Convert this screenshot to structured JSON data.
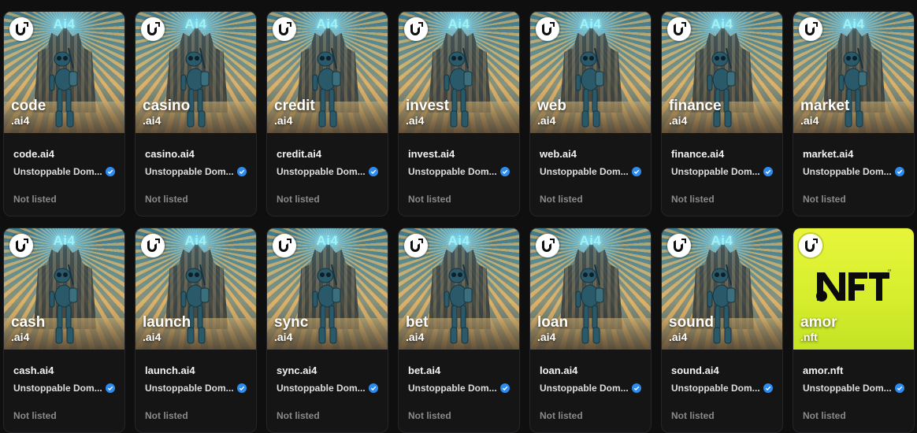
{
  "cards": [
    {
      "name": "code",
      "ext": ".ai4",
      "title": "code.ai4",
      "owner": "Unstoppable Dom...",
      "status": "Not listed",
      "brand": "Ai4",
      "style": "ai4"
    },
    {
      "name": "casino",
      "ext": ".ai4",
      "title": "casino.ai4",
      "owner": "Unstoppable Dom...",
      "status": "Not listed",
      "brand": "Ai4",
      "style": "ai4"
    },
    {
      "name": "credit",
      "ext": ".ai4",
      "title": "credit.ai4",
      "owner": "Unstoppable Dom...",
      "status": "Not listed",
      "brand": "Ai4",
      "style": "ai4"
    },
    {
      "name": "invest",
      "ext": ".ai4",
      "title": "invest.ai4",
      "owner": "Unstoppable Dom...",
      "status": "Not listed",
      "brand": "Ai4",
      "style": "ai4"
    },
    {
      "name": "web",
      "ext": ".ai4",
      "title": "web.ai4",
      "owner": "Unstoppable Dom...",
      "status": "Not listed",
      "brand": "Ai4",
      "style": "ai4"
    },
    {
      "name": "finance",
      "ext": ".ai4",
      "title": "finance.ai4",
      "owner": "Unstoppable Dom...",
      "status": "Not listed",
      "brand": "Ai4",
      "style": "ai4"
    },
    {
      "name": "market",
      "ext": ".ai4",
      "title": "market.ai4",
      "owner": "Unstoppable Dom...",
      "status": "Not listed",
      "brand": "Ai4",
      "style": "ai4"
    },
    {
      "name": "cash",
      "ext": ".ai4",
      "title": "cash.ai4",
      "owner": "Unstoppable Dom...",
      "status": "Not listed",
      "brand": "Ai4",
      "style": "ai4"
    },
    {
      "name": "launch",
      "ext": ".ai4",
      "title": "launch.ai4",
      "owner": "Unstoppable Dom...",
      "status": "Not listed",
      "brand": "Ai4",
      "style": "ai4"
    },
    {
      "name": "sync",
      "ext": ".ai4",
      "title": "sync.ai4",
      "owner": "Unstoppable Dom...",
      "status": "Not listed",
      "brand": "Ai4",
      "style": "ai4"
    },
    {
      "name": "bet",
      "ext": ".ai4",
      "title": "bet.ai4",
      "owner": "Unstoppable Dom...",
      "status": "Not listed",
      "brand": "Ai4",
      "style": "ai4"
    },
    {
      "name": "loan",
      "ext": ".ai4",
      "title": "loan.ai4",
      "owner": "Unstoppable Dom...",
      "status": "Not listed",
      "brand": "Ai4",
      "style": "ai4"
    },
    {
      "name": "sound",
      "ext": ".ai4",
      "title": "sound.ai4",
      "owner": "Unstoppable Dom...",
      "status": "Not listed",
      "brand": "Ai4",
      "style": "ai4"
    },
    {
      "name": "amor",
      "ext": ".nft",
      "title": "amor.nft",
      "owner": "Unstoppable Dom...",
      "status": "Not listed",
      "brand": "NFT",
      "style": "nft"
    }
  ],
  "icons": {
    "logo": "unstoppable-domains-logo-icon",
    "verified": "verified-badge-icon"
  },
  "colors": {
    "verified": "#2d8cf0",
    "nft_bg": "#dcf032",
    "brand_glow": "#9ff3f4"
  }
}
